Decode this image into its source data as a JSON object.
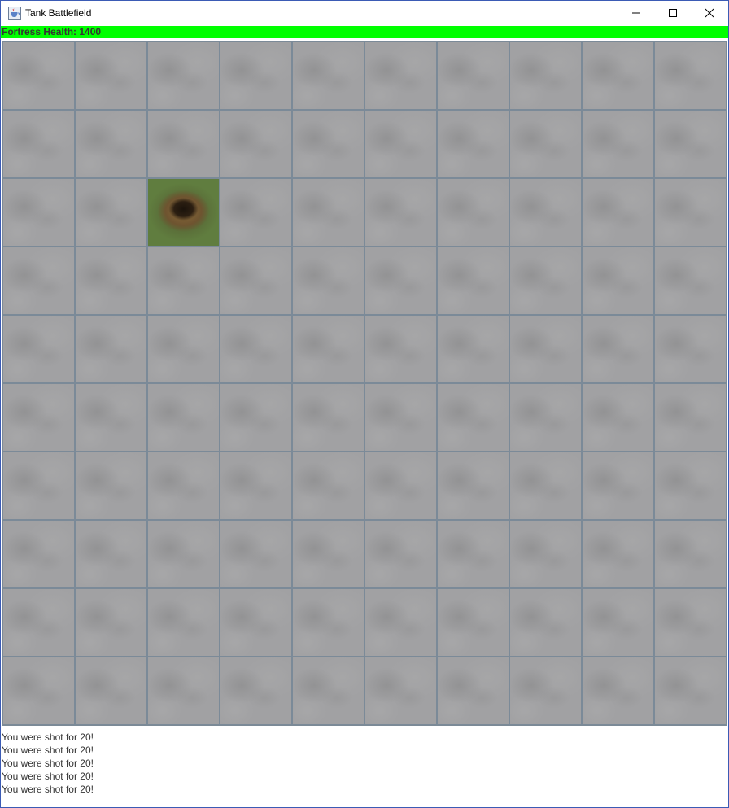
{
  "window": {
    "title": "Tank Battlefield",
    "icon": "java-cup-icon",
    "controls": {
      "minimize": "minimize-icon",
      "maximize": "maximize-icon",
      "close": "close-icon"
    }
  },
  "status": {
    "health_label": "Fortress Health: 1400",
    "bar_color": "#00ff00"
  },
  "battlefield": {
    "rows": 10,
    "cols": 10,
    "terrain": [
      [
        "concrete",
        "concrete",
        "concrete",
        "concrete",
        "concrete",
        "concrete",
        "concrete",
        "concrete",
        "concrete",
        "concrete"
      ],
      [
        "concrete",
        "concrete",
        "concrete",
        "concrete",
        "concrete",
        "concrete",
        "concrete",
        "concrete",
        "concrete",
        "concrete"
      ],
      [
        "concrete",
        "concrete",
        "crater",
        "concrete",
        "concrete",
        "concrete",
        "concrete",
        "concrete",
        "concrete",
        "concrete"
      ],
      [
        "concrete",
        "concrete",
        "concrete",
        "concrete",
        "concrete",
        "concrete",
        "concrete",
        "concrete",
        "concrete",
        "concrete"
      ],
      [
        "concrete",
        "concrete",
        "concrete",
        "concrete",
        "concrete",
        "concrete",
        "concrete",
        "concrete",
        "concrete",
        "concrete"
      ],
      [
        "concrete",
        "concrete",
        "concrete",
        "concrete",
        "concrete",
        "concrete",
        "concrete",
        "concrete",
        "concrete",
        "concrete"
      ],
      [
        "concrete",
        "concrete",
        "concrete",
        "concrete",
        "concrete",
        "concrete",
        "concrete",
        "concrete",
        "concrete",
        "concrete"
      ],
      [
        "concrete",
        "concrete",
        "concrete",
        "concrete",
        "concrete",
        "concrete",
        "concrete",
        "concrete",
        "concrete",
        "concrete"
      ],
      [
        "concrete",
        "concrete",
        "concrete",
        "concrete",
        "concrete",
        "concrete",
        "concrete",
        "concrete",
        "concrete",
        "concrete"
      ],
      [
        "concrete",
        "concrete",
        "concrete",
        "concrete",
        "concrete",
        "concrete",
        "concrete",
        "concrete",
        "concrete",
        "concrete"
      ]
    ]
  },
  "log": [
    "You were shot for 20!",
    "You were shot for 20!",
    "You were shot for 20!",
    "You were shot for 20!",
    "You were shot for 20!"
  ]
}
